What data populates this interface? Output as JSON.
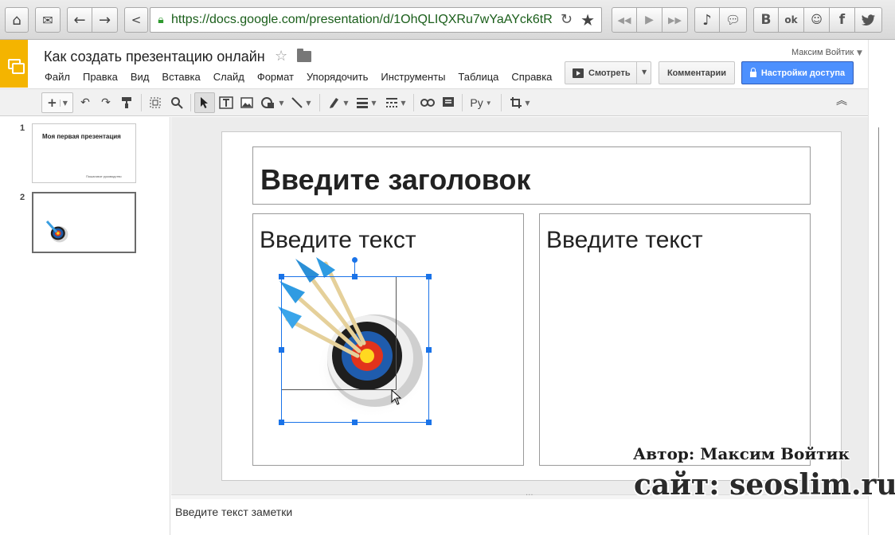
{
  "browser": {
    "url": "https://docs.google.com/presentation/d/1OhQLIQXRu7wYaAYck6tR",
    "social_vk": "B",
    "social_ok": "ok",
    "social_fb": "f"
  },
  "doc": {
    "title": "Как создать презентацию онлайн",
    "user": "Максим Войтик"
  },
  "menu": [
    "Файл",
    "Правка",
    "Вид",
    "Вставка",
    "Слайд",
    "Формат",
    "Упорядочить",
    "Инструменты",
    "Таблица",
    "Справка"
  ],
  "header_buttons": {
    "present": "Смотреть",
    "comments": "Комментарии",
    "share": "Настройки доступа"
  },
  "toolbar": {
    "language": "Ру"
  },
  "slides_panel": {
    "slide1_number": "1",
    "slide1_title": "Моя первая презентация",
    "slide1_subtitle": "Пошаговое руководство",
    "slide2_number": "2"
  },
  "slide": {
    "title_placeholder": "Введите заголовок",
    "left_body_placeholder": "Введите текст",
    "right_body_placeholder": "Введите текст"
  },
  "notes": {
    "placeholder": "Введите текст заметки"
  },
  "watermark": {
    "author": "Автор: Максим Войтик",
    "site": "сайт: seoslim.ru"
  },
  "colors": {
    "docs_accent": "#f4b400",
    "share_button": "#4d90fe",
    "selection": "#1a73e8",
    "url_text": "#1a5e1a"
  },
  "icons": {
    "browser": [
      "home-icon",
      "mail-icon",
      "back-icon",
      "forward-icon",
      "share-icon",
      "lock-icon",
      "reload-icon",
      "star-icon",
      "rewind-icon",
      "play-icon",
      "fast-forward-icon",
      "music-icon",
      "chat-icon",
      "vk-icon",
      "odnoklassniki-icon",
      "friends-icon",
      "facebook-icon",
      "twitter-icon"
    ],
    "toolbar": [
      "new-slide-icon",
      "undo-icon",
      "redo-icon",
      "paint-format-icon",
      "zoom-fit-icon",
      "zoom-icon",
      "select-icon",
      "textbox-icon",
      "image-icon",
      "shape-icon",
      "line-icon",
      "border-color-icon",
      "border-weight-icon",
      "border-dash-icon",
      "link-icon",
      "comment-icon",
      "crop-icon",
      "collapse-icon"
    ]
  }
}
